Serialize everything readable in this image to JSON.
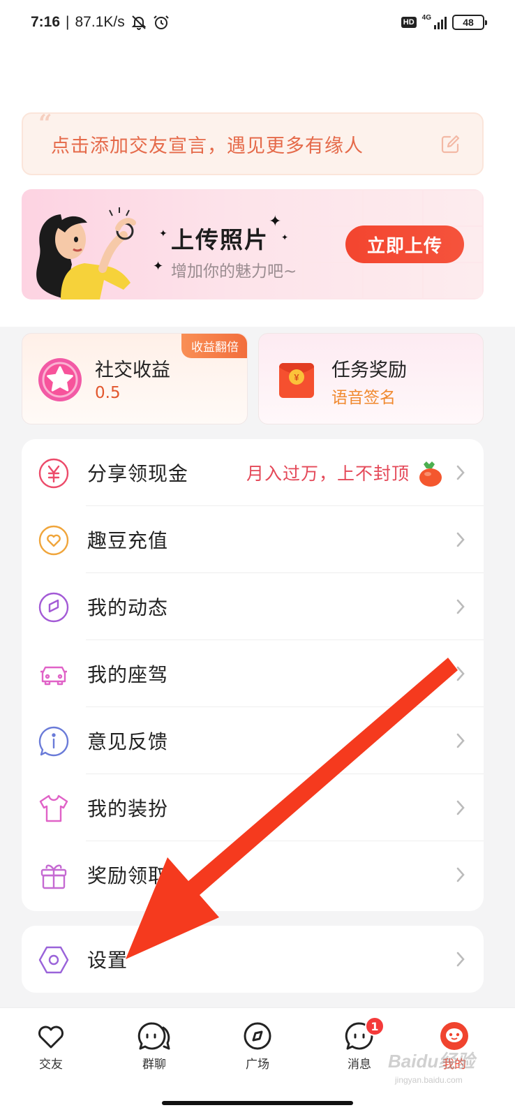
{
  "status_bar": {
    "time": "7:16",
    "separator": "|",
    "speed": "87.1K/s",
    "hd": "HD",
    "network": "4G",
    "battery": "48"
  },
  "motto": {
    "text": "点击添加交友宣言，遇见更多有缘人"
  },
  "upload_banner": {
    "title": "上传照片",
    "subtitle": "增加你的魅力吧~",
    "button": "立即上传"
  },
  "income_card": {
    "badge": "收益翻倍",
    "title": "社交收益",
    "value": "0.5"
  },
  "task_card": {
    "title": "任务奖励",
    "value": "语音签名"
  },
  "menu": {
    "items": [
      {
        "label": "分享领现金",
        "promo": "月入过万，上不封顶",
        "icon": "yuan-circle-icon"
      },
      {
        "label": "趣豆充值",
        "icon": "heart-circle-icon"
      },
      {
        "label": "我的动态",
        "icon": "compass-leaf-icon"
      },
      {
        "label": "我的座驾",
        "icon": "car-icon"
      },
      {
        "label": "意见反馈",
        "icon": "info-bubble-icon"
      },
      {
        "label": "我的装扮",
        "icon": "tshirt-icon"
      },
      {
        "label": "奖励领取",
        "icon": "gift-box-icon"
      }
    ]
  },
  "settings": {
    "label": "设置",
    "icon": "hexagon-gear-icon"
  },
  "bottom_nav": {
    "items": [
      {
        "label": "交友",
        "icon": "heart-icon"
      },
      {
        "label": "群聊",
        "icon": "group-chat-icon"
      },
      {
        "label": "广场",
        "icon": "compass-icon"
      },
      {
        "label": "消息",
        "icon": "message-icon",
        "badge": "1"
      },
      {
        "label": "我的",
        "icon": "profile-icon",
        "active": true
      }
    ]
  },
  "watermark": {
    "text": "Baidu经验",
    "sub": "jingyan.baidu.com"
  },
  "colors": {
    "accent": "#f0432e",
    "motto_text": "#e56a4a",
    "promo_text": "#e44858",
    "annotation_arrow": "#f53a1e"
  }
}
